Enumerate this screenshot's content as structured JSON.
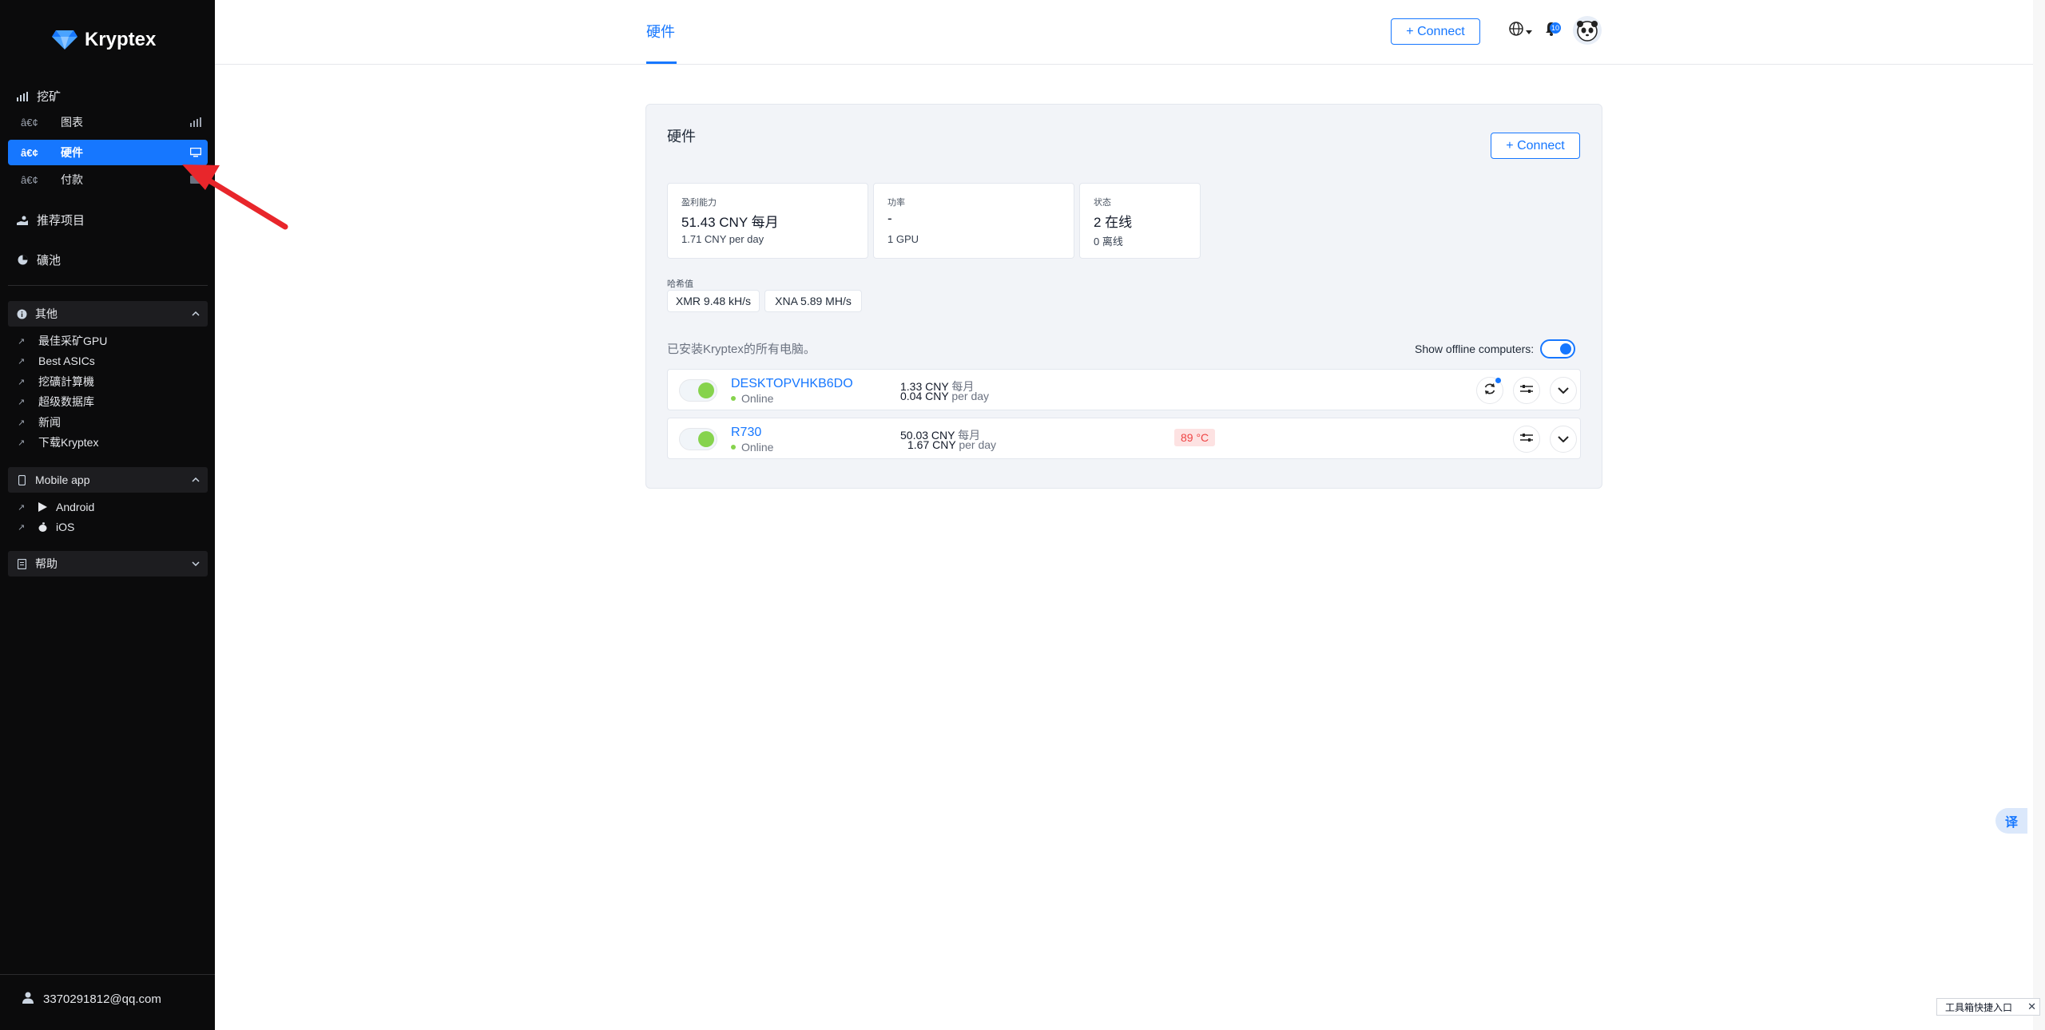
{
  "brand": {
    "name": "Kryptex"
  },
  "sidebar": {
    "mining": {
      "label": "挖矿"
    },
    "mining_items": [
      {
        "dots": "â€¢",
        "label": "图表",
        "icon": "bar-chart-icon",
        "active": false
      },
      {
        "dots": "â€¢",
        "label": "硬件",
        "icon": "monitor-icon",
        "active": true
      },
      {
        "dots": "â€¢",
        "label": "付款",
        "icon": "wallet-icon",
        "active": false
      }
    ],
    "referrals": {
      "label": "推荐项目"
    },
    "pools": {
      "label": "礦池"
    },
    "other": {
      "label": "其他",
      "links": [
        {
          "label": "最佳采矿GPU"
        },
        {
          "label": "Best ASICs"
        },
        {
          "label": "挖礦計算機"
        },
        {
          "label": "超级数据库"
        },
        {
          "label": "新闻"
        },
        {
          "label": "下载Kryptex"
        }
      ]
    },
    "mobile": {
      "label": "Mobile app",
      "links": [
        {
          "label": "Android",
          "icon": "play-icon"
        },
        {
          "label": "iOS",
          "icon": "apple-icon"
        }
      ]
    },
    "help": {
      "label": "帮助"
    },
    "user": {
      "email": "3370291812@qq.com"
    }
  },
  "topbar": {
    "tab": "硬件",
    "connect_label": "+ Connect",
    "notifications": "10"
  },
  "hardware": {
    "title": "硬件",
    "connect_label": "+ Connect",
    "stats": [
      {
        "title": "盈利能力",
        "value": "51.43 CNY 每月",
        "sub": "1.71 CNY per day"
      },
      {
        "title": "功率",
        "value": "-",
        "sub": "1 GPU"
      },
      {
        "title": "状态",
        "value": "2 在线",
        "sub": "0 离线"
      }
    ],
    "hashrate_label": "哈希值",
    "hashrates": [
      "XMR 9.48 kH/s",
      "XNA 5.89 MH/s"
    ],
    "list_title": "已安装Kryptex的所有电脑。",
    "show_offline_label": "Show offline computers:",
    "computers": [
      {
        "name": "DESKTOPVHKB6DO",
        "status": "Online",
        "monthly": "1.33 CNY",
        "monthly_unit": "每月",
        "daily": "0.04 CNY",
        "daily_unit": "per day",
        "temp": ""
      },
      {
        "name": "R730",
        "status": "Online",
        "monthly": "50.03 CNY",
        "monthly_unit": "每月",
        "daily": "1.67 CNY",
        "daily_unit": "per day",
        "temp": "89 °C"
      }
    ]
  },
  "widgets": {
    "translate_label": "译",
    "toolbox_label": "工具箱快捷入口",
    "toolbox_close": "✕"
  },
  "colors": {
    "accent": "#1677ff",
    "sidebar_bg": "#0b0b0c",
    "online": "#86d34d",
    "temp_bg": "#fde2e2"
  }
}
